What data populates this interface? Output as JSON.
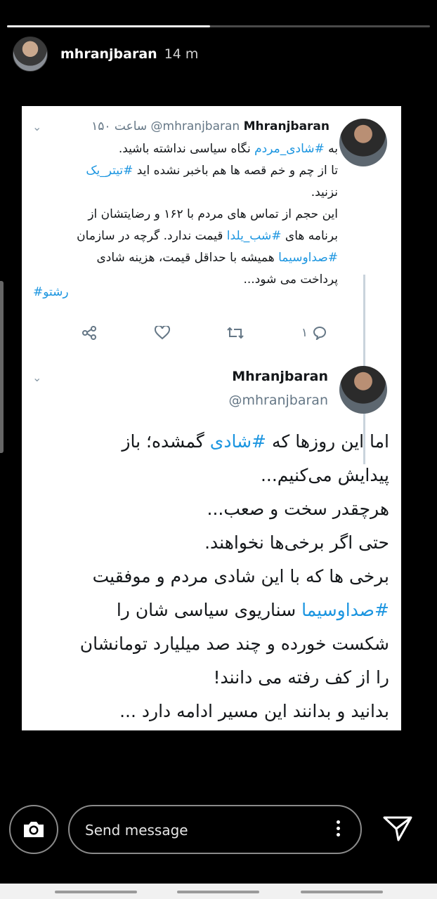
{
  "story": {
    "progress": 0.48,
    "username": "mhranjbaran",
    "time": "14 m"
  },
  "tweet1": {
    "name": "Mhranjbaran",
    "handle": "@mhranjbaran",
    "meta": "۱۵۰ ساعت",
    "lines": [
      [
        "به ",
        "#شادی_مردم",
        " نگاه سیاسی نداشته باشید."
      ],
      [
        "تا از چم و خم قصه ها هم باخبر نشده اید ",
        "#تیتر_یک",
        ""
      ],
      [
        "نزنید.",
        "",
        ""
      ],
      [
        "این حجم از تماس های مردم با ۱۶۲ و رضایتشان از",
        "",
        ""
      ],
      [
        "برنامه های ",
        "#شب_یلدا",
        " قیمت ندارد. گرچه در سازمان"
      ],
      [
        "",
        "#صداوسیما",
        " همیشه با حداقل قیمت، هزینه شادی"
      ],
      [
        "پرداخت می شود...",
        "",
        ""
      ]
    ],
    "hashtag": "#رشتو",
    "reply_count": "۱"
  },
  "tweet2": {
    "name": "Mhranjbaran",
    "handle": "@mhranjbaran",
    "lines": [
      [
        "اما این روزها که ",
        "#شادی",
        " گمشده؛ باز"
      ],
      [
        "پیدایش می‌کنیم...",
        "",
        ""
      ],
      [
        "هرچقدر سخت و صعب...",
        "",
        ""
      ],
      [
        "حتی اگر برخی‌ها نخواهند.",
        "",
        ""
      ],
      [
        "برخی ها که با این شادی مردم و موفقیت",
        "",
        ""
      ],
      [
        "",
        "#صداوسیما",
        " سناریوی سیاسی شان را"
      ],
      [
        "شکست خورده و چند صد میلیارد تومانشان",
        "",
        ""
      ],
      [
        "را از کف رفته می دانند!",
        "",
        ""
      ],
      [
        "بدانید و بدانند این مسیر ادامه دارد ...",
        "",
        ""
      ]
    ]
  },
  "footer": {
    "placeholder": "Send message"
  },
  "icons": {
    "camera": "camera-icon",
    "more": "more-vertical-icon",
    "send": "send-icon"
  }
}
